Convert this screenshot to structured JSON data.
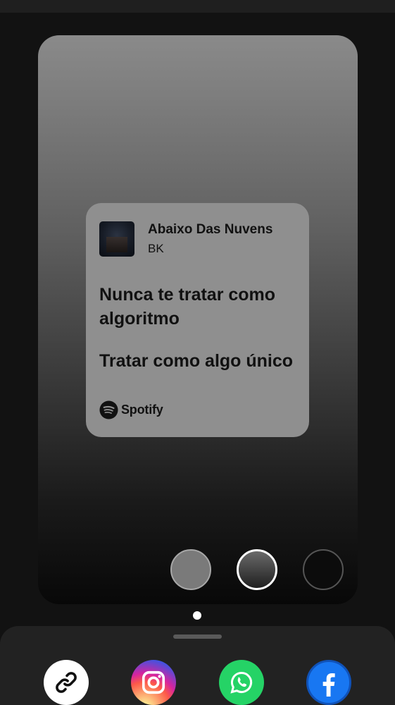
{
  "track": {
    "title": "Abaixo Das Nuvens",
    "artist": "BK"
  },
  "lyrics": [
    "Nunca te tratar como algoritmo",
    "Tratar como algo único"
  ],
  "branding": {
    "name": "Spotify",
    "icon": "spotify-logo"
  },
  "background_options": [
    {
      "name": "gray",
      "color": "#7a7a7a",
      "selected": false
    },
    {
      "name": "gradient",
      "color": "#3a3a3a",
      "selected": true
    },
    {
      "name": "black",
      "color": "#0c0c0c",
      "selected": false
    }
  ],
  "pager": {
    "pages": 1,
    "current": 1
  },
  "share_targets": [
    {
      "name": "Copy link",
      "icon": "link-icon",
      "color": "#ffffff"
    },
    {
      "name": "Instagram",
      "icon": "instagram-icon",
      "color": "#d6249f"
    },
    {
      "name": "WhatsApp",
      "icon": "whatsapp-icon",
      "color": "#25d366"
    },
    {
      "name": "Facebook",
      "icon": "facebook-icon",
      "color": "#1877f2"
    }
  ]
}
